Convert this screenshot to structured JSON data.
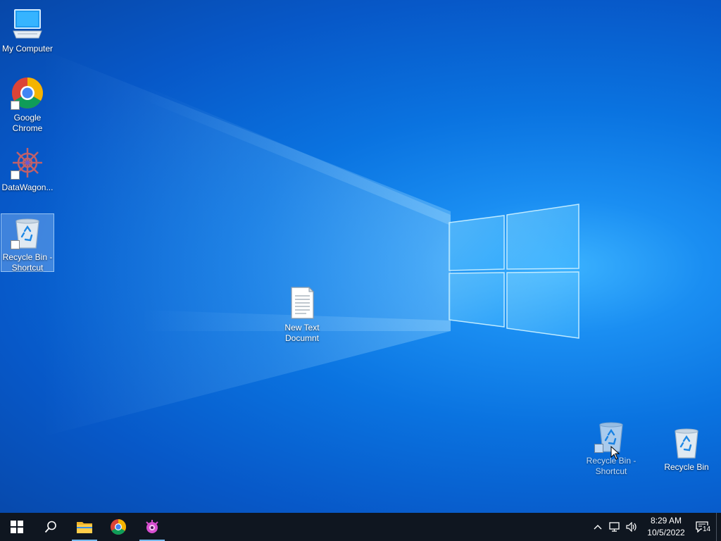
{
  "desktop": {
    "icons": [
      {
        "label": "My Computer",
        "icon": "computer-icon"
      },
      {
        "label": "Google Chrome",
        "icon": "chrome-icon"
      },
      {
        "label": "DataWagon...",
        "icon": "datawagon-icon"
      },
      {
        "label": "Recycle Bin - Shortcut",
        "icon": "recycle-bin-icon",
        "selected": true
      },
      {
        "label": "New Text Documnt",
        "icon": "text-document-icon"
      },
      {
        "label": "Recycle Bin - Shortcut",
        "icon": "recycle-bin-icon"
      },
      {
        "label": "Recycle Bin",
        "icon": "recycle-bin-icon"
      }
    ]
  },
  "taskbar": {
    "buttons": [
      "windows-start-icon",
      "search-icon",
      "file-explorer-icon",
      "chrome-icon",
      "app-icon"
    ],
    "tray": {
      "icons": [
        "chevron-up-icon",
        "network-icon",
        "volume-icon"
      ],
      "time": "8:29 AM",
      "date": "10/5/2022",
      "notification_count": "14"
    }
  },
  "colors": {
    "taskbar": "#0f1620",
    "desktop_accent": "#0a73e0",
    "taskbar_active_indicator": "#76b9ed"
  }
}
